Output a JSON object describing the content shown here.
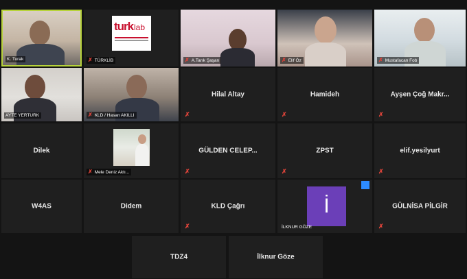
{
  "participants": [
    {
      "name": "K. Turak",
      "display_name": "",
      "muted": false,
      "active": true,
      "video": true
    },
    {
      "name": "TÜRKLİB",
      "display_name": "",
      "muted": true,
      "active": false,
      "video": true,
      "logo": {
        "word": "turk",
        "suffix": "lab"
      }
    },
    {
      "name": "A.Tarık Şaşan",
      "display_name": "",
      "muted": true,
      "active": false,
      "video": true
    },
    {
      "name": "Elif Öz",
      "display_name": "",
      "muted": true,
      "active": false,
      "video": true
    },
    {
      "name": "Mustafacan Fob",
      "display_name": "",
      "muted": true,
      "active": false,
      "video": true
    },
    {
      "name": "AYTE YERTURK",
      "display_name": "",
      "muted": false,
      "active": false,
      "video": true
    },
    {
      "name": "KLD / Hasan AKILLI",
      "display_name": "",
      "muted": true,
      "active": false,
      "video": true
    },
    {
      "name": "",
      "display_name": "Hilal Altay",
      "muted": true,
      "active": false,
      "video": false
    },
    {
      "name": "",
      "display_name": "Hamideh",
      "muted": true,
      "active": false,
      "video": false
    },
    {
      "name": "",
      "display_name": "Ayşen Çoğ Makr...",
      "muted": true,
      "active": false,
      "video": false
    },
    {
      "name": "",
      "display_name": "Dilek",
      "muted": false,
      "active": false,
      "video": false
    },
    {
      "name": "Mele Deniz Aktı...",
      "display_name": "",
      "muted": true,
      "active": false,
      "video": true
    },
    {
      "name": "",
      "display_name": "GÜLDEN CELEP...",
      "muted": true,
      "active": false,
      "video": false
    },
    {
      "name": "",
      "display_name": "ZPST",
      "muted": true,
      "active": false,
      "video": false
    },
    {
      "name": "",
      "display_name": "elif.yesilyurt",
      "muted": true,
      "active": false,
      "video": false
    },
    {
      "name": "",
      "display_name": "W4AS",
      "muted": false,
      "active": false,
      "video": false
    },
    {
      "name": "",
      "display_name": "Didem",
      "muted": false,
      "active": false,
      "video": false
    },
    {
      "name": "",
      "display_name": "KLD Çağrı",
      "muted": true,
      "active": false,
      "video": false
    },
    {
      "name": "İLKNUR GÖZE",
      "display_name": "",
      "muted": false,
      "active": false,
      "video": false,
      "avatar_letter": "İ",
      "avatar_color": "#6b3fb8"
    },
    {
      "name": "",
      "display_name": "GÜLNİSA PİLGİR",
      "muted": true,
      "active": false,
      "video": false
    },
    {
      "name": "",
      "display_name": "TDZ4",
      "muted": false,
      "active": false,
      "video": false
    },
    {
      "name": "",
      "display_name": "İlknur Göze",
      "muted": false,
      "active": false,
      "video": false
    }
  ],
  "muted_icon": "✗",
  "colors": {
    "tile": "#1f1f1f",
    "background": "#141414",
    "active_border": "#b7d33a",
    "muted": "#e0443a",
    "badge": "#2d8cff"
  }
}
